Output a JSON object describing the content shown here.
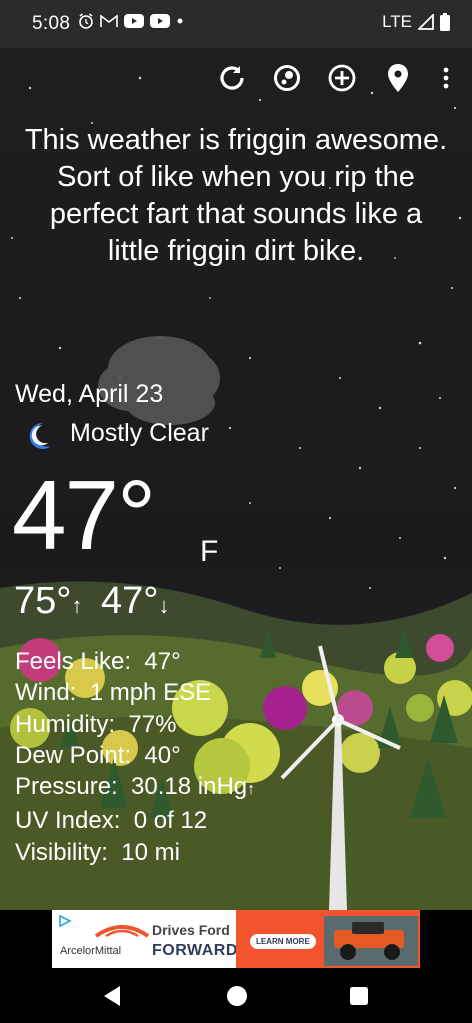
{
  "status_bar": {
    "time": "5:08",
    "network": "LTE"
  },
  "toolbar": {
    "icons": [
      "refresh-icon",
      "radar-icon",
      "add-location-icon",
      "location-pin-icon",
      "more-options-icon"
    ]
  },
  "quote": "This weather is friggin awesome. Sort of like when you rip the perfect fart that sounds like a little friggin dirt bike.",
  "weather": {
    "date": "Wed, April 23",
    "condition": "Mostly Clear",
    "temperature": "47°",
    "unit": "F",
    "high": "75°",
    "low": "47°"
  },
  "details": [
    {
      "label": "Feels Like:",
      "value": "47°"
    },
    {
      "label": "Wind:",
      "value": "1 mph ESE"
    },
    {
      "label": "Humidity:",
      "value": "77%"
    },
    {
      "label": "Dew Point:",
      "value": "40°"
    },
    {
      "label": "Pressure:",
      "value": "30.18 inHg",
      "trend": "↑"
    },
    {
      "label": "UV Index:",
      "value": "0 of 12"
    },
    {
      "label": "Visibility:",
      "value": "10 mi"
    }
  ],
  "ad": {
    "brand": "ArcelorMittal",
    "headline_1": "Drives Ford",
    "headline_2": "FORWARD.",
    "cta": "LEARN MORE"
  },
  "colors": {
    "accent_moon": "#3a7be0",
    "ad_orange": "#f2542d"
  }
}
